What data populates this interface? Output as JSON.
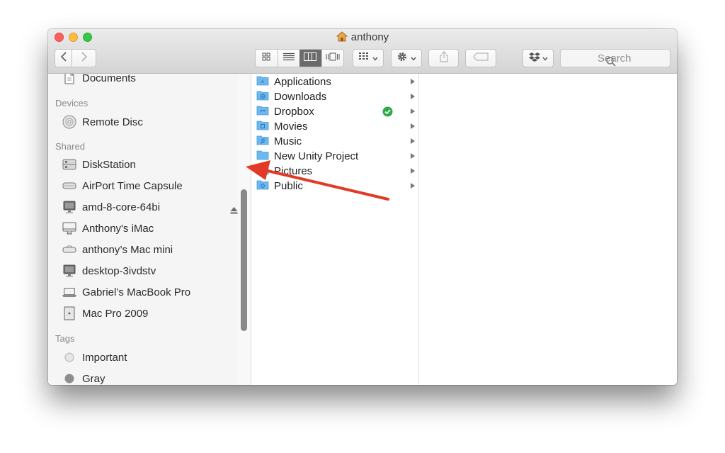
{
  "window": {
    "title": "anthony",
    "title_icon": "home-icon"
  },
  "toolbar": {
    "back": "chevron-left-icon",
    "forward": "chevron-right-icon",
    "views": [
      "icon-view-icon",
      "list-view-icon",
      "column-view-icon",
      "cover-flow-icon"
    ],
    "selected_view": "column-view-icon",
    "arrange": "arrange-grid-icon",
    "action": "gear-icon",
    "share": "share-icon",
    "tags": "tag-icon",
    "dropbox": "dropbox-icon",
    "search_placeholder": "Search"
  },
  "sidebar": {
    "top_items": [
      {
        "label": "Documents",
        "icon": "document-icon"
      }
    ],
    "sections": [
      {
        "heading": "Devices",
        "items": [
          {
            "label": "Remote Disc",
            "icon": "disc-icon"
          }
        ]
      },
      {
        "heading": "Shared",
        "items": [
          {
            "label": "DiskStation",
            "icon": "server-icon"
          },
          {
            "label": "AirPort Time Capsule",
            "icon": "airport-icon"
          },
          {
            "label": "amd-8-core-64bi",
            "icon": "monitor-icon"
          },
          {
            "label": "Anthony's iMac",
            "icon": "imac-icon"
          },
          {
            "label": "anthony’s Mac mini",
            "icon": "mac-mini-icon"
          },
          {
            "label": "desktop-3ivdstv",
            "icon": "monitor-icon"
          },
          {
            "label": "Gabriel’s MacBook Pro",
            "icon": "laptop-icon"
          },
          {
            "label": "Mac Pro 2009",
            "icon": "mac-pro-icon"
          }
        ]
      },
      {
        "heading": "Tags",
        "items": [
          {
            "label": "Important",
            "icon": "tag-dot-icon",
            "color": "#e6e6e6"
          },
          {
            "label": "Gray",
            "icon": "tag-dot-icon",
            "color": "#8e8e8e"
          }
        ]
      }
    ]
  },
  "column1": {
    "items": [
      {
        "label": "Applications",
        "glyph": "A"
      },
      {
        "label": "Downloads",
        "glyph": "↓"
      },
      {
        "label": "Dropbox",
        "glyph": "❖",
        "synced": true
      },
      {
        "label": "Movies",
        "glyph": "▣"
      },
      {
        "label": "Music",
        "glyph": "♫"
      },
      {
        "label": "New Unity Project",
        "glyph": ""
      },
      {
        "label": "Pictures",
        "glyph": "▨"
      },
      {
        "label": "Public",
        "glyph": "◆"
      }
    ]
  },
  "colors": {
    "folder": "#6cb9f2",
    "sync_ok": "#2dab48",
    "annotation_arrow": "#e23a26"
  }
}
